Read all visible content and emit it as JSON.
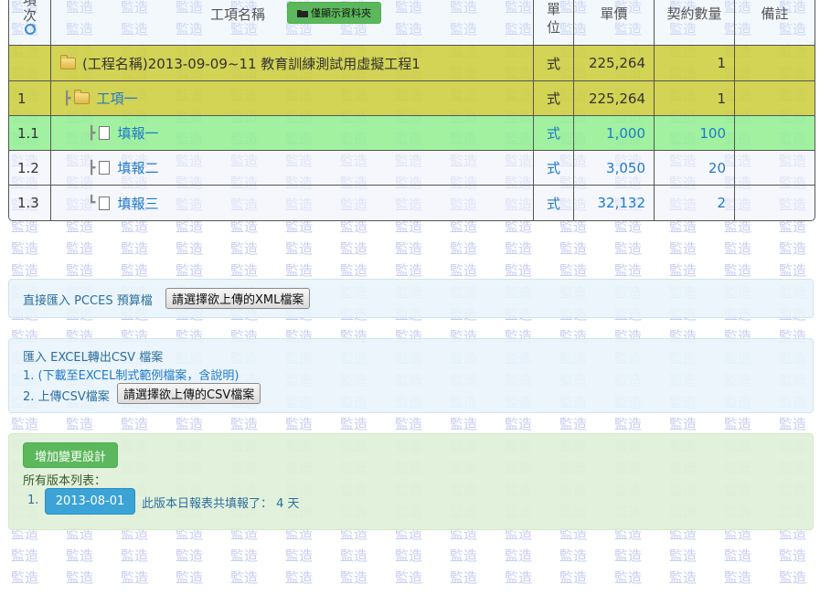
{
  "watermark_text": "監造",
  "table": {
    "headers": {
      "no_line1": "項",
      "no_line2": "次",
      "name": "工項名稱",
      "folder_only_button": "僅顯示資料夾",
      "unit_line1": "單",
      "unit_line2": "位",
      "price": "單價",
      "qty": "契約數量",
      "note": "備註"
    },
    "rows": [
      {
        "no": "",
        "name": "(工程名稱)2013-09-09~11 教育訓練測試用虛擬工程1",
        "unit": "式",
        "price": "225,264",
        "qty": "1",
        "note": ""
      },
      {
        "no": "1",
        "name": "工項一",
        "unit": "式",
        "price": "225,264",
        "qty": "1",
        "note": ""
      },
      {
        "no": "1.1",
        "name": "填報一",
        "unit": "式",
        "price": "1,000",
        "qty": "100",
        "note": ""
      },
      {
        "no": "1.2",
        "name": "填報二",
        "unit": "式",
        "price": "3,050",
        "qty": "20",
        "note": ""
      },
      {
        "no": "1.3",
        "name": "填報三",
        "unit": "式",
        "price": "32,132",
        "qty": "2",
        "note": ""
      }
    ]
  },
  "pcces_panel": {
    "label": "直接匯入 PCCES 預算檔",
    "button": "請選擇欲上傳的XML檔案"
  },
  "excel_panel": {
    "title": "匯入 EXCEL轉出CSV 檔案",
    "step1": "1. (下載至EXCEL制式範例檔案，含說明)",
    "step2": "2. 上傳CSV檔案",
    "button": "請選擇欲上傳的CSV檔案"
  },
  "version_panel": {
    "add_button": "增加變更設計",
    "list_label": "所有版本列表：",
    "item_index": "1.",
    "version_date": "2013-08-01",
    "version_note": "此版本日報表共填報了： 4 天"
  },
  "colors": {
    "project_row": "#cece42",
    "highlight_row": "#90ee90",
    "link_blue": "#1f7ac9",
    "green_button": "#5cb85c",
    "blue_button": "#3ba3d6"
  }
}
